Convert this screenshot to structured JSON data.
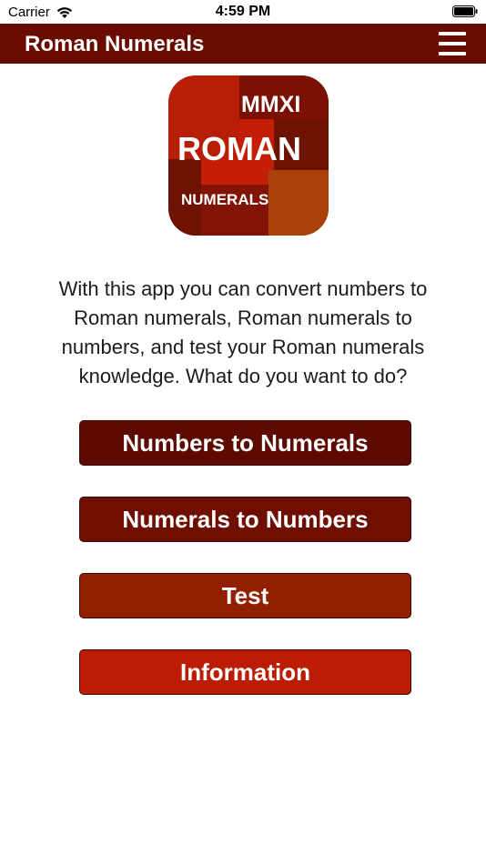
{
  "status_bar": {
    "carrier": "Carrier",
    "time": "4:59 PM",
    "wifi_icon": "wifi-icon",
    "battery_icon": "battery-icon"
  },
  "nav": {
    "title": "Roman Numerals",
    "menu_icon": "hamburger-menu-icon",
    "background": "#6a0d00"
  },
  "logo": {
    "line1": "MMXI",
    "line2": "ROMAN",
    "line3": "NUMERALS"
  },
  "intro_text": "With this app you can convert numbers to Roman numerals, Roman numerals to numbers, and test your Roman numerals knowledge. What do you want to do?",
  "buttons": [
    {
      "label": "Numbers to Numerals",
      "color": "#5c0a02"
    },
    {
      "label": "Numerals to Numbers",
      "color": "#6e0f02"
    },
    {
      "label": "Test",
      "color": "#922000"
    },
    {
      "label": "Information",
      "color": "#bb1c03"
    }
  ]
}
